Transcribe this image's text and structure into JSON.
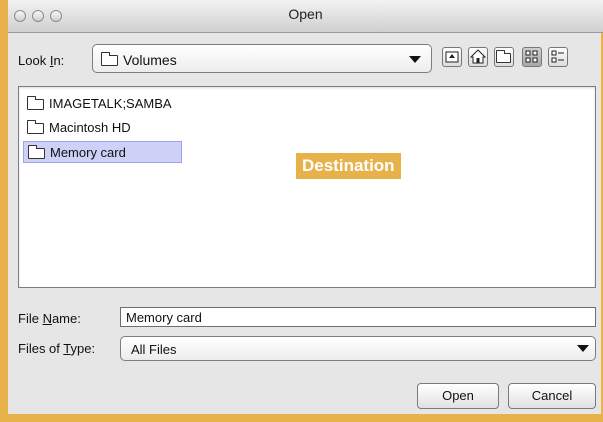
{
  "window": {
    "title": "Open"
  },
  "look_in": {
    "label_prefix": "Look ",
    "label_mnemonic": "I",
    "label_suffix": "n:",
    "value": "Volumes"
  },
  "toolbar": {
    "icons": [
      "up-folder-icon",
      "home-icon",
      "new-folder-icon",
      "list-view-icon",
      "details-view-icon"
    ]
  },
  "files": [
    {
      "name": "IMAGETALK;SAMBA",
      "selected": false
    },
    {
      "name": "Macintosh HD",
      "selected": false
    },
    {
      "name": "Memory card",
      "selected": true
    }
  ],
  "annotation": {
    "text": "Destination",
    "color": "#e8b24a"
  },
  "file_name": {
    "label_prefix": "File ",
    "label_mnemonic": "N",
    "label_suffix": "ame:",
    "value": "Memory card"
  },
  "file_type": {
    "label_prefix": "Files of ",
    "label_mnemonic": "T",
    "label_suffix": "ype:",
    "value": "All Files"
  },
  "buttons": {
    "open": "Open",
    "cancel": "Cancel"
  }
}
